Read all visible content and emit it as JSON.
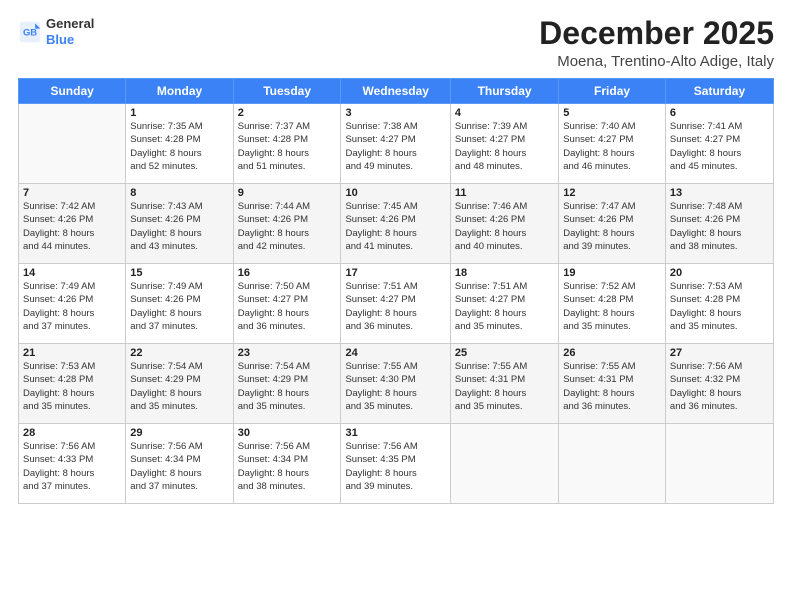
{
  "logo": {
    "line1": "General",
    "line2": "Blue"
  },
  "title": "December 2025",
  "location": "Moena, Trentino-Alto Adige, Italy",
  "weekdays": [
    "Sunday",
    "Monday",
    "Tuesday",
    "Wednesday",
    "Thursday",
    "Friday",
    "Saturday"
  ],
  "weeks": [
    [
      {
        "day": "",
        "info": ""
      },
      {
        "day": "1",
        "info": "Sunrise: 7:35 AM\nSunset: 4:28 PM\nDaylight: 8 hours\nand 52 minutes."
      },
      {
        "day": "2",
        "info": "Sunrise: 7:37 AM\nSunset: 4:28 PM\nDaylight: 8 hours\nand 51 minutes."
      },
      {
        "day": "3",
        "info": "Sunrise: 7:38 AM\nSunset: 4:27 PM\nDaylight: 8 hours\nand 49 minutes."
      },
      {
        "day": "4",
        "info": "Sunrise: 7:39 AM\nSunset: 4:27 PM\nDaylight: 8 hours\nand 48 minutes."
      },
      {
        "day": "5",
        "info": "Sunrise: 7:40 AM\nSunset: 4:27 PM\nDaylight: 8 hours\nand 46 minutes."
      },
      {
        "day": "6",
        "info": "Sunrise: 7:41 AM\nSunset: 4:27 PM\nDaylight: 8 hours\nand 45 minutes."
      }
    ],
    [
      {
        "day": "7",
        "info": "Sunrise: 7:42 AM\nSunset: 4:26 PM\nDaylight: 8 hours\nand 44 minutes."
      },
      {
        "day": "8",
        "info": "Sunrise: 7:43 AM\nSunset: 4:26 PM\nDaylight: 8 hours\nand 43 minutes."
      },
      {
        "day": "9",
        "info": "Sunrise: 7:44 AM\nSunset: 4:26 PM\nDaylight: 8 hours\nand 42 minutes."
      },
      {
        "day": "10",
        "info": "Sunrise: 7:45 AM\nSunset: 4:26 PM\nDaylight: 8 hours\nand 41 minutes."
      },
      {
        "day": "11",
        "info": "Sunrise: 7:46 AM\nSunset: 4:26 PM\nDaylight: 8 hours\nand 40 minutes."
      },
      {
        "day": "12",
        "info": "Sunrise: 7:47 AM\nSunset: 4:26 PM\nDaylight: 8 hours\nand 39 minutes."
      },
      {
        "day": "13",
        "info": "Sunrise: 7:48 AM\nSunset: 4:26 PM\nDaylight: 8 hours\nand 38 minutes."
      }
    ],
    [
      {
        "day": "14",
        "info": "Sunrise: 7:49 AM\nSunset: 4:26 PM\nDaylight: 8 hours\nand 37 minutes."
      },
      {
        "day": "15",
        "info": "Sunrise: 7:49 AM\nSunset: 4:26 PM\nDaylight: 8 hours\nand 37 minutes."
      },
      {
        "day": "16",
        "info": "Sunrise: 7:50 AM\nSunset: 4:27 PM\nDaylight: 8 hours\nand 36 minutes."
      },
      {
        "day": "17",
        "info": "Sunrise: 7:51 AM\nSunset: 4:27 PM\nDaylight: 8 hours\nand 36 minutes."
      },
      {
        "day": "18",
        "info": "Sunrise: 7:51 AM\nSunset: 4:27 PM\nDaylight: 8 hours\nand 35 minutes."
      },
      {
        "day": "19",
        "info": "Sunrise: 7:52 AM\nSunset: 4:28 PM\nDaylight: 8 hours\nand 35 minutes."
      },
      {
        "day": "20",
        "info": "Sunrise: 7:53 AM\nSunset: 4:28 PM\nDaylight: 8 hours\nand 35 minutes."
      }
    ],
    [
      {
        "day": "21",
        "info": "Sunrise: 7:53 AM\nSunset: 4:28 PM\nDaylight: 8 hours\nand 35 minutes."
      },
      {
        "day": "22",
        "info": "Sunrise: 7:54 AM\nSunset: 4:29 PM\nDaylight: 8 hours\nand 35 minutes."
      },
      {
        "day": "23",
        "info": "Sunrise: 7:54 AM\nSunset: 4:29 PM\nDaylight: 8 hours\nand 35 minutes."
      },
      {
        "day": "24",
        "info": "Sunrise: 7:55 AM\nSunset: 4:30 PM\nDaylight: 8 hours\nand 35 minutes."
      },
      {
        "day": "25",
        "info": "Sunrise: 7:55 AM\nSunset: 4:31 PM\nDaylight: 8 hours\nand 35 minutes."
      },
      {
        "day": "26",
        "info": "Sunrise: 7:55 AM\nSunset: 4:31 PM\nDaylight: 8 hours\nand 36 minutes."
      },
      {
        "day": "27",
        "info": "Sunrise: 7:56 AM\nSunset: 4:32 PM\nDaylight: 8 hours\nand 36 minutes."
      }
    ],
    [
      {
        "day": "28",
        "info": "Sunrise: 7:56 AM\nSunset: 4:33 PM\nDaylight: 8 hours\nand 37 minutes."
      },
      {
        "day": "29",
        "info": "Sunrise: 7:56 AM\nSunset: 4:34 PM\nDaylight: 8 hours\nand 37 minutes."
      },
      {
        "day": "30",
        "info": "Sunrise: 7:56 AM\nSunset: 4:34 PM\nDaylight: 8 hours\nand 38 minutes."
      },
      {
        "day": "31",
        "info": "Sunrise: 7:56 AM\nSunset: 4:35 PM\nDaylight: 8 hours\nand 39 minutes."
      },
      {
        "day": "",
        "info": ""
      },
      {
        "day": "",
        "info": ""
      },
      {
        "day": "",
        "info": ""
      }
    ]
  ]
}
